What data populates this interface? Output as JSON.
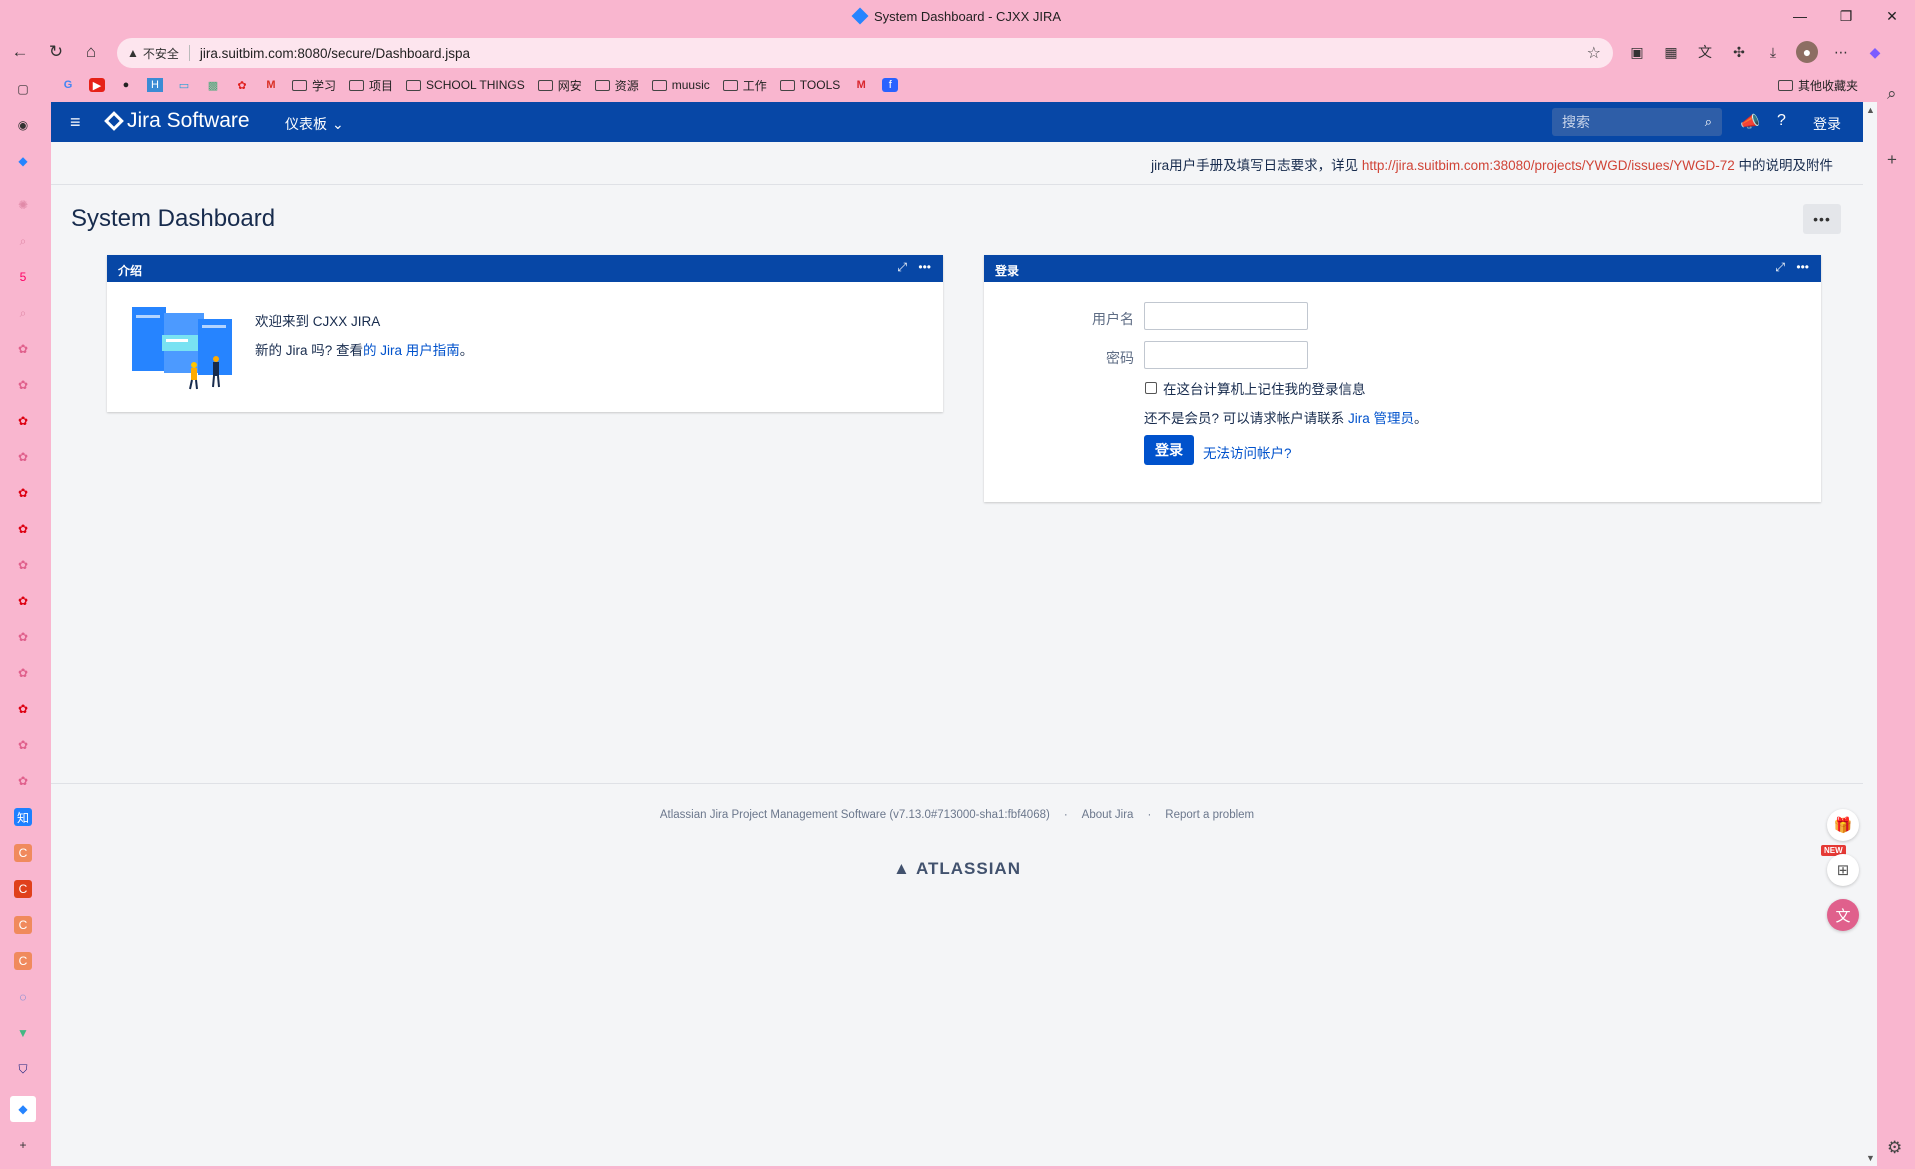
{
  "browser": {
    "window_title": "System Dashboard - CJXX JIRA",
    "address": {
      "security_label": "不安全",
      "url": "jira.suitbim.com:8080/secure/Dashboard.jspa"
    },
    "bookmarks": [
      "学习",
      "项目",
      "SCHOOL THINGS",
      "网安",
      "资源",
      "muusic",
      "工作",
      "TOOLS"
    ],
    "other_bookmarks": "其他收藏夹"
  },
  "jira": {
    "product_name": "Jira Software",
    "dashboards_menu": "仪表板",
    "search_placeholder": "搜索",
    "login_link": "登录",
    "banner": {
      "prefix": "jira用户手册及填写日志要求，详见",
      "link": "http://jira.suitbim.com:38080/projects/YWGD/issues/YWGD-72",
      "suffix": "中的说明及附件"
    },
    "page_title": "System Dashboard",
    "tools_button": "•••",
    "intro_gadget": {
      "title": "介绍",
      "welcome": "欢迎来到 CJXX JIRA",
      "guide_prefix": "新的 Jira 吗? 查看",
      "guide_link": "的 Jira 用户指南",
      "guide_suffix": "。"
    },
    "login_gadget": {
      "title": "登录",
      "username_label": "用户名",
      "password_label": "密码",
      "remember_label": "在这台计算机上记住我的登录信息",
      "not_member_prefix": "还不是会员? 可以请求帐户请联系",
      "admin_link": "Jira 管理员",
      "not_member_suffix": "。",
      "login_button": "登录",
      "cant_access": "无法访问帐户?"
    },
    "footer": {
      "version": "Atlassian Jira Project Management Software (v7.13.0#713000-sha1:fbf4068)",
      "about": "About Jira",
      "report": "Report a problem",
      "separator": "·",
      "brand": "ATLASSIAN"
    },
    "floating_new_badge": "NEW"
  },
  "colors": {
    "header": "#0747a6",
    "link": "#0052cc",
    "banner_link": "#d04437",
    "browser_bg": "#f9b6cf"
  }
}
